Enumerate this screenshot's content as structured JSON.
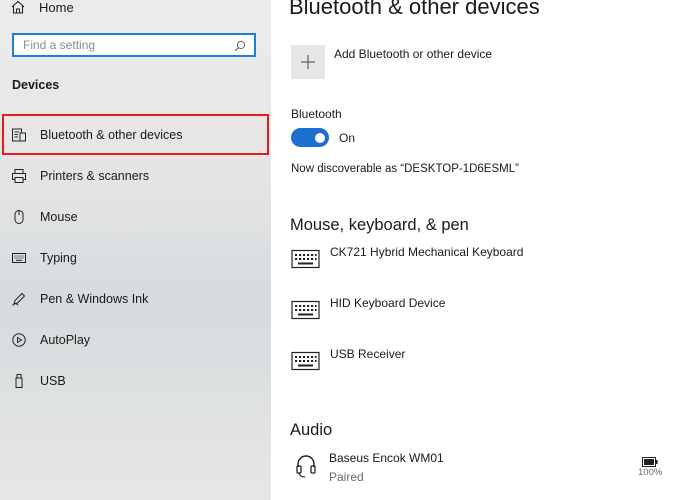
{
  "sidebar": {
    "home_label": "Home",
    "search_placeholder": "Find a setting",
    "section_title": "Devices",
    "items": [
      {
        "label": "Bluetooth & other devices",
        "icon": "bluetooth-devices-icon",
        "selected": true
      },
      {
        "label": "Printers & scanners",
        "icon": "printer-icon",
        "selected": false
      },
      {
        "label": "Mouse",
        "icon": "mouse-icon",
        "selected": false
      },
      {
        "label": "Typing",
        "icon": "keyboard-icon",
        "selected": false
      },
      {
        "label": "Pen & Windows Ink",
        "icon": "pen-icon",
        "selected": false
      },
      {
        "label": "AutoPlay",
        "icon": "autoplay-icon",
        "selected": false
      },
      {
        "label": "USB",
        "icon": "usb-icon",
        "selected": false
      }
    ]
  },
  "main": {
    "title": "Bluetooth & other devices",
    "add_device_label": "Add Bluetooth or other device",
    "bluetooth_label": "Bluetooth",
    "bluetooth_state": "On",
    "discoverable_text": "Now discoverable as “DESKTOP-1D6ESML”",
    "input_section_title": "Mouse, keyboard, & pen",
    "input_devices": [
      {
        "name": "CK721 Hybrid Mechanical Keyboard",
        "icon": "keyboard-icon"
      },
      {
        "name": "HID Keyboard Device",
        "icon": "keyboard-icon"
      },
      {
        "name": "USB Receiver",
        "icon": "keyboard-icon"
      }
    ],
    "audio_section_title": "Audio",
    "audio_devices": [
      {
        "name": "Baseus Encok WM01",
        "status": "Paired",
        "battery": "100%",
        "icon": "headset-icon"
      }
    ]
  },
  "colors": {
    "accent": "#1b6fd0",
    "search_border": "#1f7fd1",
    "selection_outline": "#e31b23"
  }
}
